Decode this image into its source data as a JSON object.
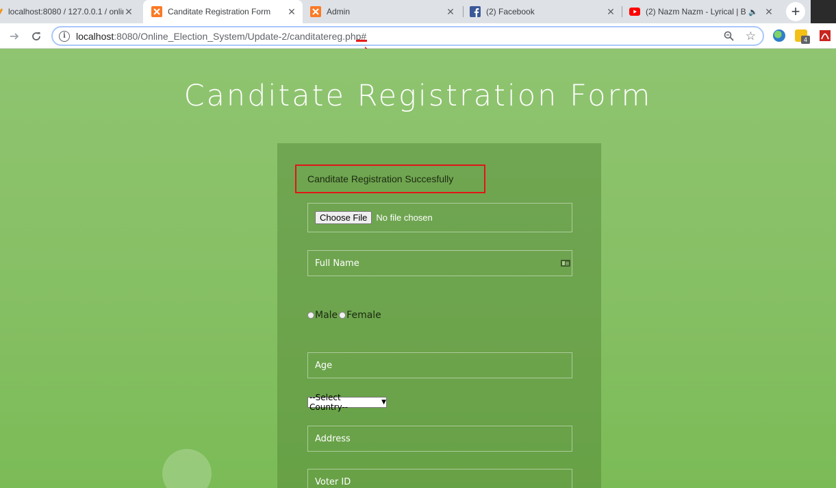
{
  "browser": {
    "tabs": [
      {
        "title": "localhost:8080 / 127.0.0.1 / onlin",
        "icon": "phpmyadmin-icon",
        "active": false
      },
      {
        "title": "Canditate Registration Form",
        "icon": "xampp-icon",
        "active": true
      },
      {
        "title": "Admin",
        "icon": "xampp-icon",
        "active": false
      },
      {
        "title": "(2) Facebook",
        "icon": "facebook-icon",
        "active": false
      },
      {
        "title": "(2) Nazm Nazm - Lyrical | B",
        "icon": "youtube-icon",
        "active": false
      }
    ],
    "new_tab_label": "+",
    "close_glyph": "✕",
    "url_host": "localhost",
    "url_path": ":8080/Online_Election_System/Update-2/canditatereg.php#",
    "extension_badge": "4",
    "colors": {
      "accent": "#a8c7fa",
      "annotation": "#e81c1c"
    }
  },
  "page": {
    "title": "Canditate Registration Form",
    "success_message": "Canditate Registration Succesfully",
    "file_button": "Choose File",
    "file_status": "No file chosen",
    "fullname_placeholder": "Full Name",
    "gender_male": "Male",
    "gender_female": "Female",
    "age_placeholder": "Age",
    "country_selected": "--Select Country--",
    "address_placeholder": "Address",
    "voter_placeholder": "Voter ID",
    "colors": {
      "background": "#8cc36a",
      "panel": "#6e9d4e",
      "success_border": "#e01515"
    }
  }
}
